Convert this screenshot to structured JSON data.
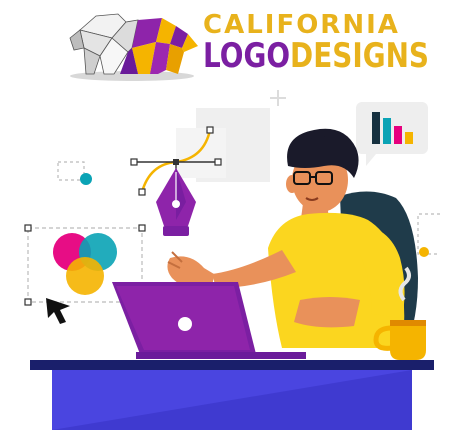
{
  "brand": {
    "line1": "CALIFORNIA",
    "line2_logo": "LOGO",
    "line2_designs": "DESIGNS"
  },
  "colors": {
    "gold": "#e8b21c",
    "purple": "#7b1fa2",
    "violet": "#8e24aa",
    "navy": "#1a1f6b",
    "yellow_shirt": "#fbd61f",
    "skin": "#e9915a",
    "desk_blue": "#3f3ad0",
    "teal": "#0aa3b5",
    "magenta": "#e6007e"
  },
  "icons": {
    "bear_logo": "polygon-bear-icon",
    "pen_tool": "pen-nib-icon",
    "color_wheel": "overlap-circles-icon",
    "cursor": "arrow-cursor-icon",
    "chart_bubble": "bar-chart-bubble-icon",
    "laptop": "laptop-icon",
    "mug": "coffee-mug-icon"
  }
}
